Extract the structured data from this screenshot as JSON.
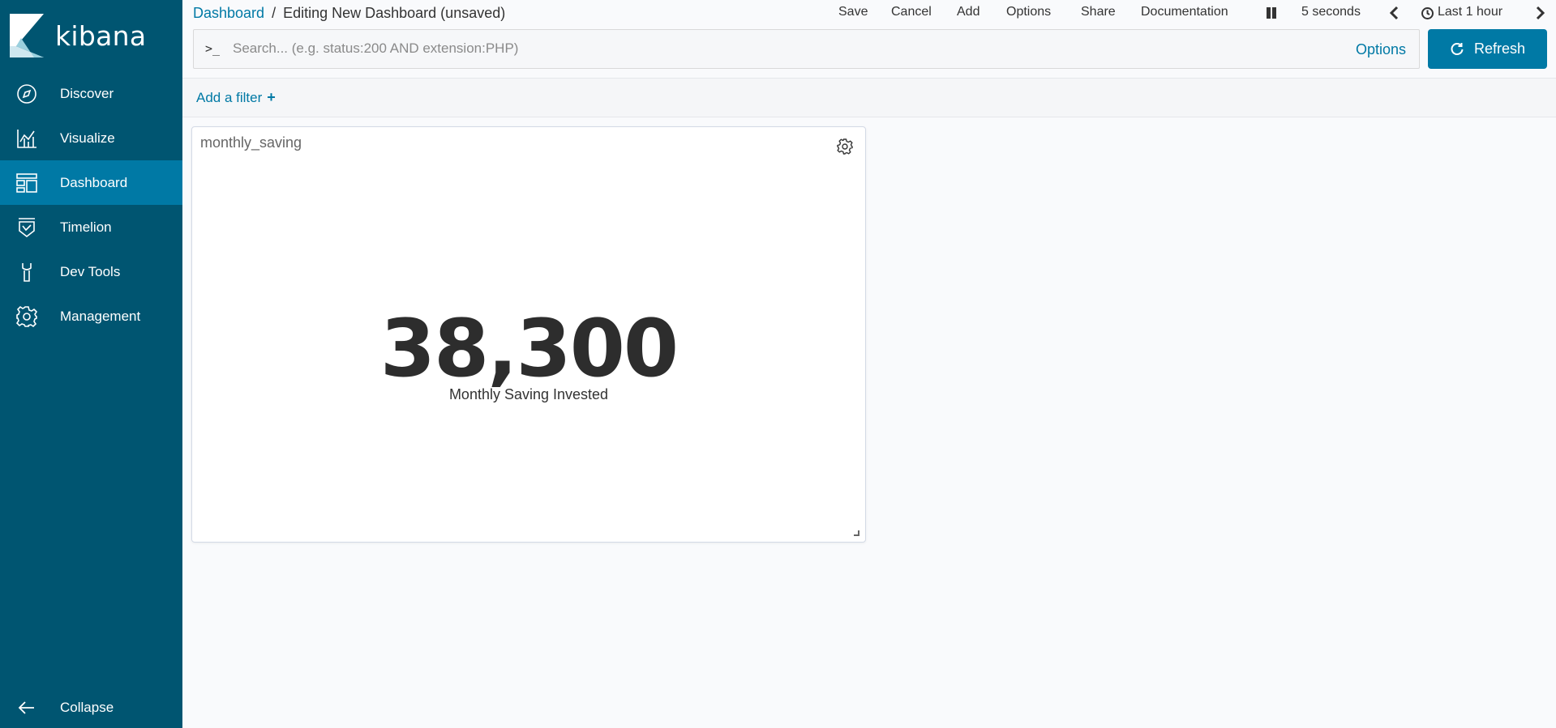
{
  "sidebar": {
    "logo_text": "kibana",
    "items": [
      {
        "label": "Discover",
        "icon": "compass-icon"
      },
      {
        "label": "Visualize",
        "icon": "chart-icon"
      },
      {
        "label": "Dashboard",
        "icon": "dashboard-icon",
        "active": true
      },
      {
        "label": "Timelion",
        "icon": "timelion-icon"
      },
      {
        "label": "Dev Tools",
        "icon": "wrench-icon"
      },
      {
        "label": "Management",
        "icon": "gear-icon"
      }
    ],
    "collapse_label": "Collapse"
  },
  "header": {
    "breadcrumb_link": "Dashboard",
    "breadcrumb_separator": "/",
    "breadcrumb_current": "Editing New Dashboard (unsaved)",
    "menu": {
      "save": "Save",
      "cancel": "Cancel",
      "add": "Add",
      "options": "Options",
      "share": "Share",
      "documentation": "Documentation",
      "refresh_interval": "5 seconds",
      "time_range": "Last 1 hour"
    }
  },
  "search": {
    "prompt": ">_",
    "placeholder": "Search... (e.g. status:200 AND extension:PHP)",
    "value": "",
    "options_label": "Options",
    "refresh_label": "Refresh"
  },
  "filter": {
    "add_filter_label": "Add a filter",
    "plus": "+"
  },
  "panel": {
    "title": "monthly_saving",
    "metric_value": "38,300",
    "metric_label": "Monthly Saving Invested"
  },
  "colors": {
    "sidebar_bg": "#005571",
    "sidebar_active": "#0079a5",
    "accent": "#0079a5"
  }
}
